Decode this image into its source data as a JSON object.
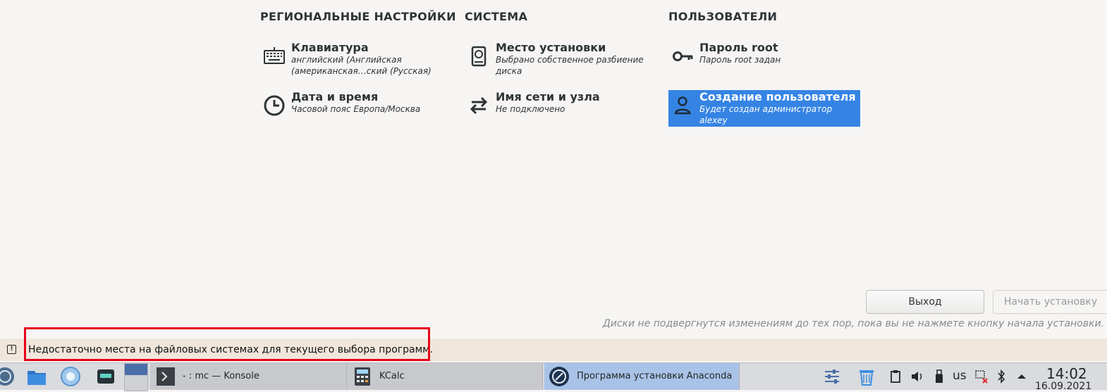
{
  "sections": {
    "regional": "РЕГИОНАЛЬНЫЕ НАСТРОЙКИ",
    "system": "СИСТЕМА",
    "users": "ПОЛЬЗОВАТЕЛИ"
  },
  "spokes": {
    "keyboard": {
      "title": "Клавиатура",
      "status": "английский (Английская (американская…ский (Русская)",
      "icon": "keyboard-icon"
    },
    "datetime": {
      "title": "Дата и время",
      "status": "Часовой пояс Европа/Москва",
      "icon": "clock-icon"
    },
    "install_dest": {
      "title": "Место установки",
      "status": "Выбрано собственное разбиение диска",
      "icon": "disk-icon"
    },
    "network": {
      "title": "Имя сети и узла",
      "status": "Не подключено",
      "icon": "network-arrows-icon"
    },
    "root_password": {
      "title": "Пароль root",
      "status": "Пароль root задан",
      "icon": "key-icon"
    },
    "user_creation": {
      "title": "Создание пользователя",
      "status": "Будет создан администратор alexey",
      "icon": "user-icon",
      "selected": true
    }
  },
  "buttons": {
    "quit": "Выход",
    "begin_install": "Начать установку"
  },
  "note": "Диски не подвергнутся изменениям до тех пор, пока вы не нажмете кнопку начала установки.",
  "warning": {
    "text": "Недостаточно места на файловых системах для текущего выбора программ.",
    "icon": "warning-icon"
  },
  "taskbar": {
    "tasks": [
      {
        "label": "- : mc — Konsole",
        "icon": "terminal-icon"
      },
      {
        "label": "KCalc",
        "icon": "calculator-icon"
      },
      {
        "label": "Программа установки Anaconda",
        "icon": "anaconda-icon",
        "active": true
      }
    ],
    "keyboard_layout": "us",
    "time": "14:02",
    "date": "16.09.2021"
  },
  "colors": {
    "selected": "#3584e4",
    "warning_bar": "#f1e6dc",
    "highlight_box": "#e8001c",
    "taskbar": "#d9dbde"
  }
}
